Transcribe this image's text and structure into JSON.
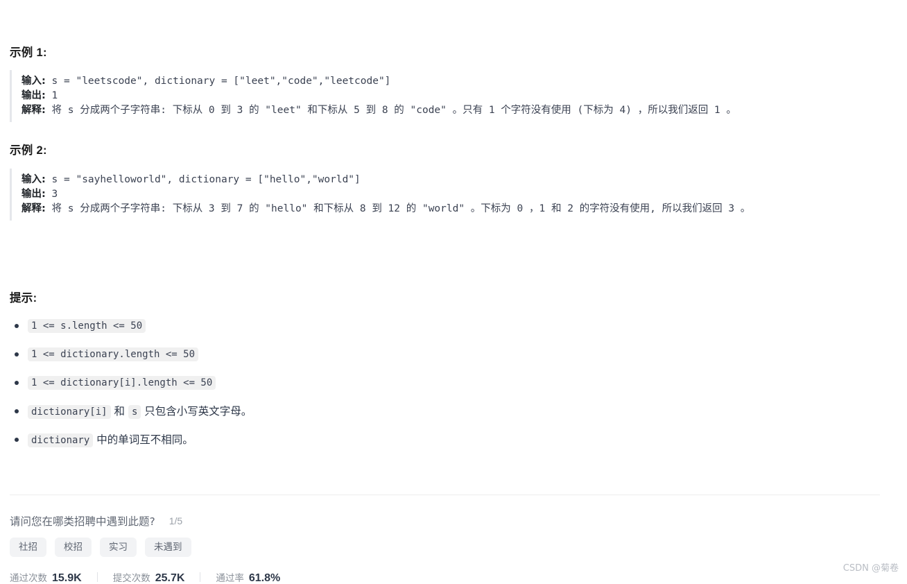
{
  "examples": [
    {
      "title": "示例 1:",
      "lines": [
        {
          "label": "输入:",
          "code": " s = \"leetscode\", dictionary = [\"leet\",\"code\",\"leetcode\"]"
        },
        {
          "label": "输出:",
          "code": " 1"
        },
        {
          "label": "解释:",
          "code": " 将 s 分成两个子字符串: 下标从 0 到 3 的 \"leet\" 和下标从 5 到 8 的 \"code\" 。只有 1 个字符没有使用 (下标为 4) ，所以我们返回 1 。"
        }
      ]
    },
    {
      "title": "示例 2:",
      "lines": [
        {
          "label": "输入:",
          "code": " s = \"sayhelloworld\", dictionary = [\"hello\",\"world\"]"
        },
        {
          "label": "输出:",
          "code": " 3"
        },
        {
          "label": "解释:",
          "code": " 将 s 分成两个子字符串: 下标从 3 到 7 的 \"hello\" 和下标从 8 到 12 的 \"world\" 。下标为 0 ，1 和 2 的字符没有使用, 所以我们返回 3 。"
        }
      ]
    }
  ],
  "hints": {
    "title": "提示:",
    "items": [
      {
        "code": "1 <= s.length <= 50",
        "text": ""
      },
      {
        "code": "1 <= dictionary.length <= 50",
        "text": ""
      },
      {
        "code": "1 <= dictionary[i].length <= 50",
        "text": ""
      },
      {
        "code": "dictionary[i]",
        "mid": " 和 ",
        "code2": "s",
        "text": " 只包含小写英文字母。"
      },
      {
        "code": "dictionary",
        "text": " 中的单词互不相同。"
      }
    ]
  },
  "poll": {
    "question": "请问您在哪类招聘中遇到此题?",
    "count": "1/5",
    "options": [
      "社招",
      "校招",
      "实习",
      "未遇到"
    ]
  },
  "stats": [
    {
      "label": "通过次数",
      "value": "15.9K"
    },
    {
      "label": "提交次数",
      "value": "25.7K"
    },
    {
      "label": "通过率",
      "value": "61.8%"
    }
  ],
  "watermark": "CSDN @菊卷"
}
